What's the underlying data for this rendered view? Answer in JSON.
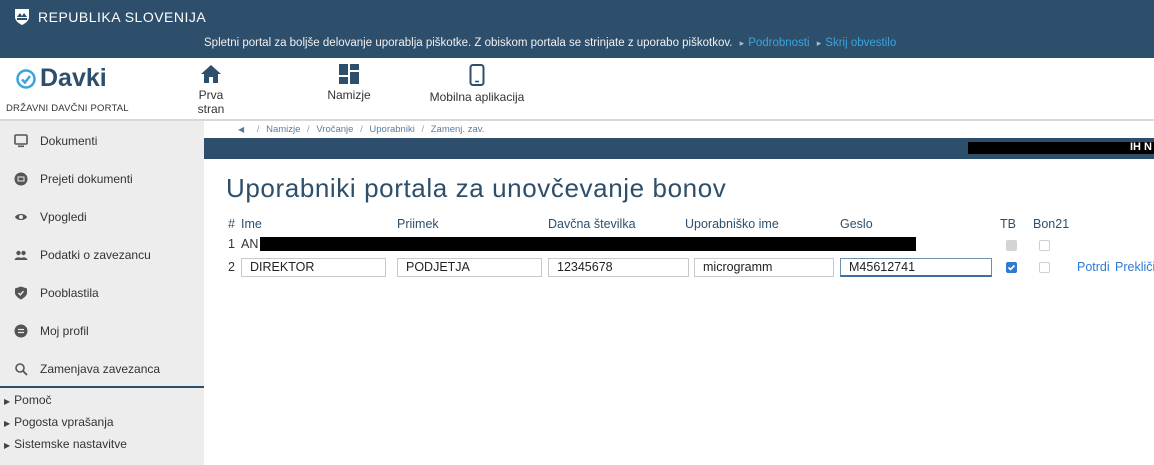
{
  "topbar": {
    "title": "REPUBLIKA SLOVENIJA",
    "cookie_text": "Spletni portal za boljše delovanje uporablja piškotke. Z obiskom portala se strinjate z uporabo piškotkov.",
    "cookie_link_details": "Podrobnosti",
    "cookie_link_hide": "Skrij obvestilo"
  },
  "nav": {
    "brand": "Davki",
    "subtitle": "DRŽAVNI DAVČNI PORTAL",
    "items": [
      {
        "label": "Prva stran",
        "icon": "home-icon"
      },
      {
        "label": "Namizje",
        "icon": "dashboard-icon"
      },
      {
        "label": "Mobilna aplikacija",
        "icon": "mobile-icon"
      }
    ]
  },
  "sidebar": {
    "items": [
      {
        "label": "Dokumenti",
        "icon": "monitor-icon"
      },
      {
        "label": "Prejeti dokumenti",
        "icon": "inbox-icon"
      },
      {
        "label": "Vpogledi",
        "icon": "eye-icon"
      },
      {
        "label": "Podatki o zavezancu",
        "icon": "users-icon"
      },
      {
        "label": "Pooblastila",
        "icon": "shield-icon"
      },
      {
        "label": "Moj profil",
        "icon": "profile-icon"
      },
      {
        "label": "Zamenjava zavezanca",
        "icon": "switch-user-icon"
      }
    ],
    "sublinks": [
      "Pomoč",
      "Pogosta vprašanja",
      "Sistemske nastavitve"
    ]
  },
  "breadcrumb": [
    "Namizje",
    "Vročanje",
    "Uporabniki",
    "Zamenj. zav."
  ],
  "header_bar": {
    "right_text": "IH N"
  },
  "page": {
    "title": "Uporabniki portala za unovčevanje bonov"
  },
  "table": {
    "headers": {
      "num": "#",
      "ime": "Ime",
      "priimek": "Priimek",
      "davcna": "Davčna številka",
      "upime": "Uporabniško ime",
      "geslo": "Geslo",
      "tb": "TB",
      "bon21": "Bon21"
    },
    "rows": [
      {
        "num": "1",
        "ime": "AN",
        "tb": true,
        "bon21": false
      },
      {
        "num": "2",
        "ime": "DIREKTOR",
        "priimek": "PODJETJA",
        "davcna": "12345678",
        "upime": "microgramm",
        "geslo": "M45612741",
        "tb": true,
        "bon21": false
      }
    ],
    "actions": {
      "confirm": "Potrdi",
      "cancel": "Prekliči"
    }
  },
  "colors": {
    "header": "#2d4f6b",
    "accent": "#3aa4de",
    "link": "#2f7bd1",
    "sidebar": "#ededed"
  }
}
